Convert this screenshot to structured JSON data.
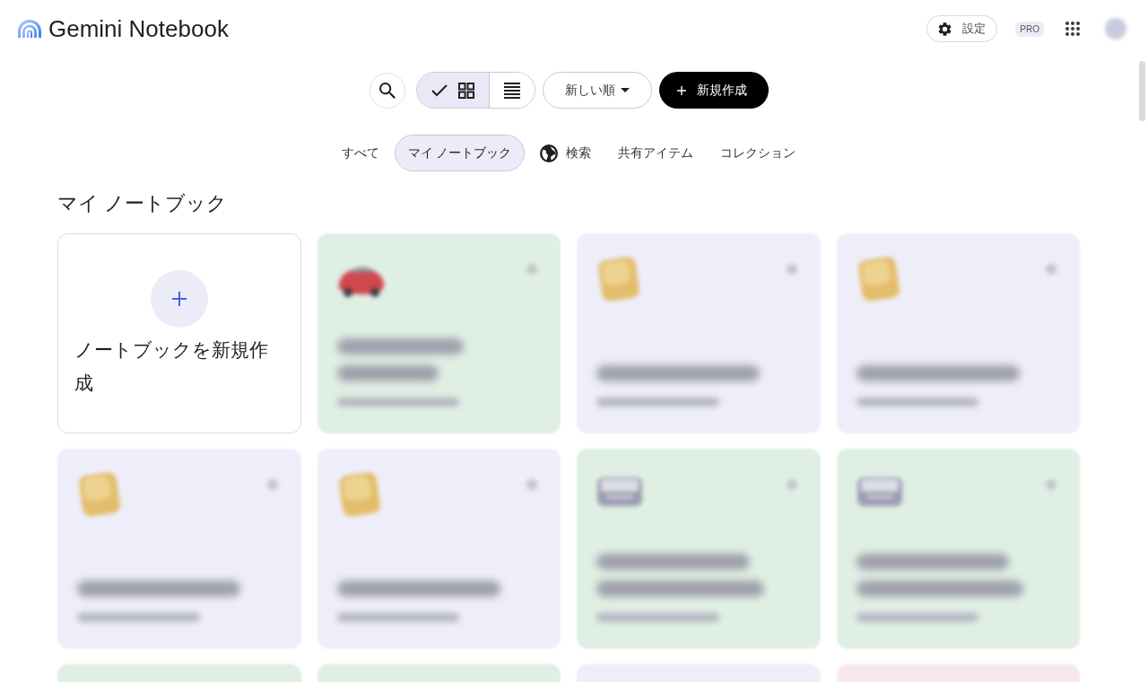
{
  "app": {
    "title": "Gemini Notebook"
  },
  "header": {
    "settings_label": "設定",
    "plan_badge": "PRO"
  },
  "toolbar": {
    "view_options": [
      {
        "kind": "grid",
        "selected": true
      },
      {
        "kind": "list",
        "selected": false
      }
    ],
    "sort_label": "新しい順",
    "new_label": "新規作成"
  },
  "tabs": [
    {
      "label": "すべて",
      "kind": "text",
      "selected": false
    },
    {
      "label": "マイ ノートブック",
      "kind": "text",
      "selected": true
    },
    {
      "label": "検索",
      "kind": "globe",
      "selected": false
    },
    {
      "label": "共有アイテム",
      "kind": "text",
      "selected": false
    },
    {
      "label": "コレクション",
      "kind": "text",
      "selected": false
    }
  ],
  "section": {
    "heading": "マイ ノートブック",
    "create_card": {
      "label": "ノートブックを新規作成"
    },
    "notebooks": [
      {
        "kind": "car",
        "color": "#e0efe4"
      },
      {
        "kind": "note",
        "color": "#eeeefa"
      },
      {
        "kind": "note",
        "color": "#eeeefa"
      },
      {
        "kind": "note",
        "color": "#eeeefa"
      },
      {
        "kind": "note",
        "color": "#eeeefa"
      },
      {
        "kind": "tray",
        "color": "#e0efe4"
      },
      {
        "kind": "tray",
        "color": "#e0efe4"
      },
      {
        "color": "#e0efe4"
      },
      {
        "color": "#e0efe4"
      },
      {
        "color": "#eeeefa"
      },
      {
        "color": "#f8e8ec"
      }
    ]
  }
}
